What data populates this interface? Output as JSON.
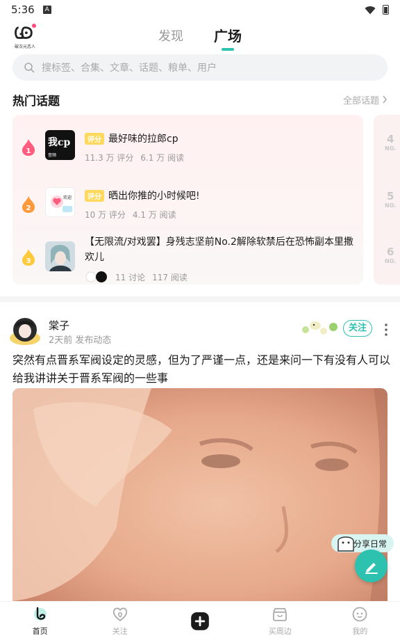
{
  "status_bar": {
    "time": "5:36",
    "notif_letter": "A"
  },
  "header": {
    "logo_text": "破次元恋人",
    "tabs": [
      {
        "label": "发现",
        "active": false
      },
      {
        "label": "广场",
        "active": true
      }
    ]
  },
  "search": {
    "placeholder": "搜标签、合集、文章、话题、粮单、用户"
  },
  "hot_topics": {
    "title": "热门话题",
    "more_label": "全部话题",
    "items": [
      {
        "rank": "1",
        "badge": "评分",
        "title": "最好味的拉郎cp",
        "meta1": "11.3 万 评分",
        "meta2": "6.1 万 阅读",
        "thumb_text": "我cp",
        "thumb_sub": "音频"
      },
      {
        "rank": "2",
        "badge": "评分",
        "title": "晒出你推的小时候吧!",
        "meta1": "10 万 评分",
        "meta2": "4.1 万 阅读",
        "thumb_text": "欢迎"
      },
      {
        "rank": "3",
        "badge": "",
        "title": "【无限流/对戏罢】身残志坚前No.2解除软禁后在恐怖副本里撒欢儿",
        "meta1": "11 讨论",
        "meta2": "117 阅读"
      }
    ],
    "next_ranks": [
      {
        "n": "4",
        "no": "NO."
      },
      {
        "n": "5",
        "no": "NO."
      },
      {
        "n": "6",
        "no": "NO."
      }
    ]
  },
  "post": {
    "author": "棠子",
    "time": "2天前 发布动态",
    "follow_label": "关注",
    "text": "突然有点晋系军阀设定的灵感，但为了严谨一点，还是来问一下有没有人可以给我讲讲关于晋系军阀的一些事"
  },
  "floating": {
    "share_label": "分享日常"
  },
  "bottom_nav": [
    {
      "label": "首页",
      "icon": "home-icon",
      "active": true
    },
    {
      "label": "关注",
      "icon": "heart-icon",
      "active": false
    },
    {
      "label": "",
      "icon": "plus-icon",
      "active": false
    },
    {
      "label": "买周边",
      "icon": "shop-icon",
      "active": false
    },
    {
      "label": "我的",
      "icon": "smile-icon",
      "active": false
    }
  ],
  "colors": {
    "accent": "#2dc2b0",
    "badge": "#ffd95e",
    "flame_1": "#ff5d7e",
    "flame_2": "#ff9a3c",
    "flame_3": "#ffc93c"
  }
}
